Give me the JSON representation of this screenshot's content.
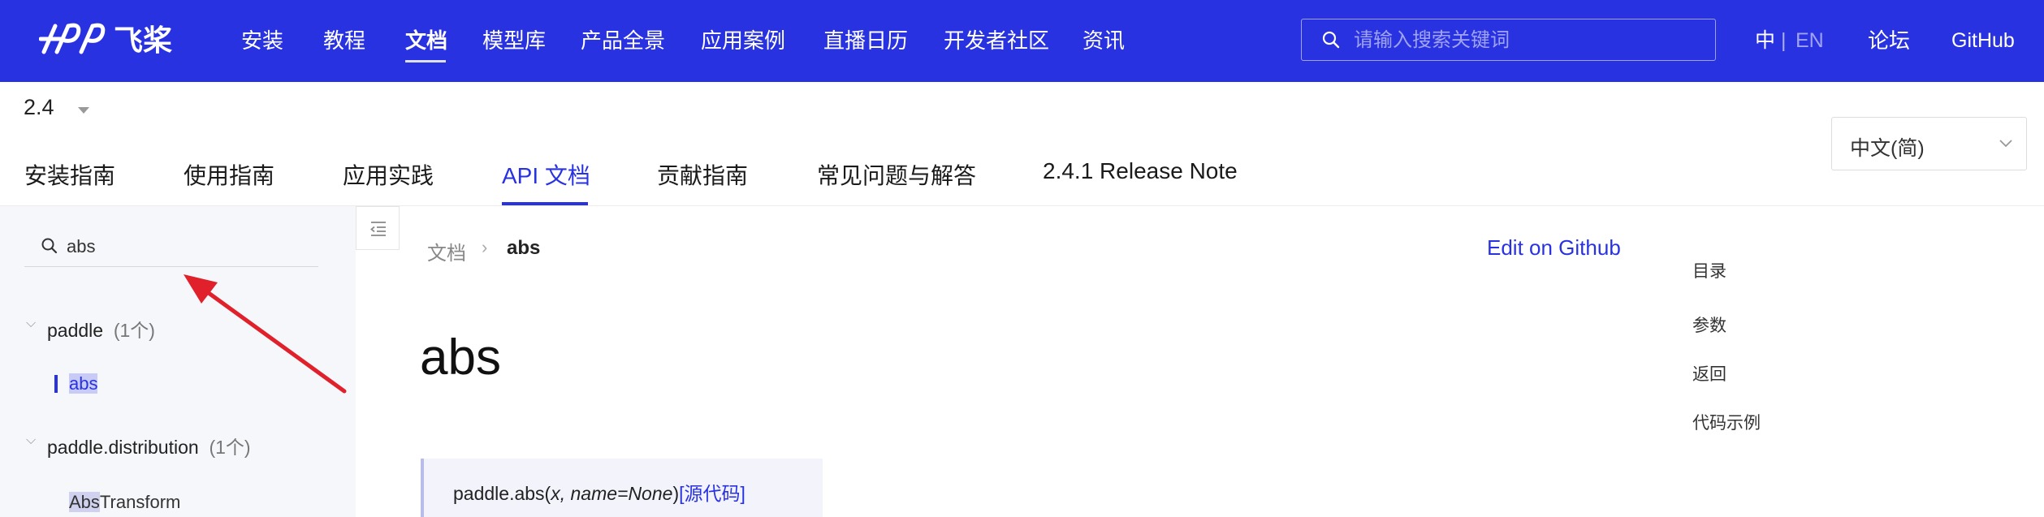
{
  "header": {
    "logo_text": "飞桨",
    "nav": [
      "安装",
      "教程",
      "文档",
      "模型库",
      "产品全景",
      "应用案例",
      "直播日历",
      "开发者社区",
      "资讯"
    ],
    "active_nav": "文档",
    "search_placeholder": "请输入搜索关键词",
    "lang_zh": "中",
    "lang_sep": "|",
    "lang_en": "EN",
    "forum": "论坛",
    "github": "GitHub",
    "brand_color": "#2932e1"
  },
  "version": "2.4",
  "subtabs": [
    "安装指南",
    "使用指南",
    "应用实践",
    "API 文档",
    "贡献指南",
    "常见问题与解答",
    "2.4.1 Release Note"
  ],
  "active_subtab": "API 文档",
  "language_select": "中文(简)",
  "sidebar": {
    "search_value": "abs",
    "groups": [
      {
        "name": "paddle",
        "count": "(1个)",
        "items": [
          "abs"
        ]
      },
      {
        "name": "paddle.distribution",
        "count": "(1个)",
        "items": [
          {
            "highlight": "Abs",
            "rest": "Transform"
          }
        ]
      }
    ]
  },
  "breadcrumb": {
    "root": "文档",
    "separator": "›",
    "current": "abs"
  },
  "edit_link": "Edit on Github",
  "title": "abs",
  "signature": {
    "prefix": "paddle.abs(",
    "params": "x, name=None",
    "suffix": ")",
    "source_link": "[源代码]"
  },
  "toc": [
    "目录",
    "参数",
    "返回",
    "代码示例"
  ],
  "annotation_arrow_color": "#e0202a",
  "icons": {
    "search": "search-icon",
    "chevron": "chevron-down-icon",
    "collapse": "collapse-sidebar-icon"
  }
}
